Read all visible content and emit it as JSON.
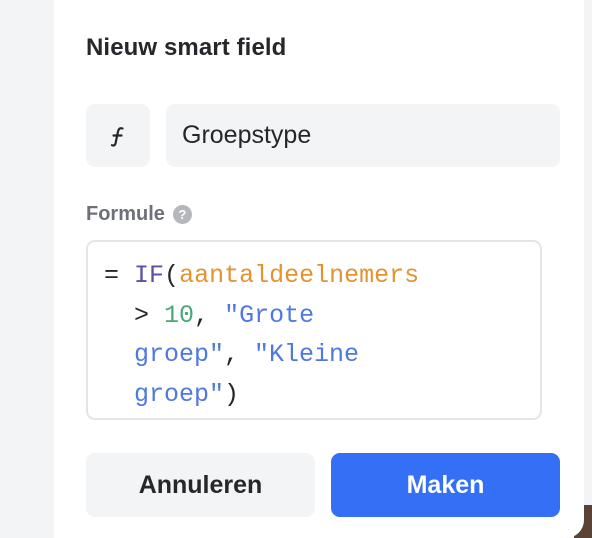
{
  "dialog": {
    "title": "Nieuw smart field",
    "icon": "function-icon",
    "name_field": {
      "value": "Groepstype",
      "placeholder": ""
    },
    "formula": {
      "label": "Formule",
      "help_icon": "question-mark-icon",
      "help_glyph": "?",
      "tokens": {
        "eq": "=",
        "fn": "IF",
        "open": "(",
        "var": "aantaldeelnemers",
        "op": "> ",
        "num": "10",
        "comma1": ", ",
        "str1_a": "\"Grote",
        "str1_b": "groep\"",
        "comma2": ", ",
        "str2_a": "\"Kleine",
        "str2_b": "groep\"",
        "close": ")"
      }
    },
    "buttons": {
      "cancel": "Annuleren",
      "create": "Maken"
    }
  },
  "colors": {
    "accent": "#3370f5",
    "function": "#5b4fa8",
    "variable": "#e3932f",
    "number": "#49a876",
    "string": "#4f78e0"
  }
}
